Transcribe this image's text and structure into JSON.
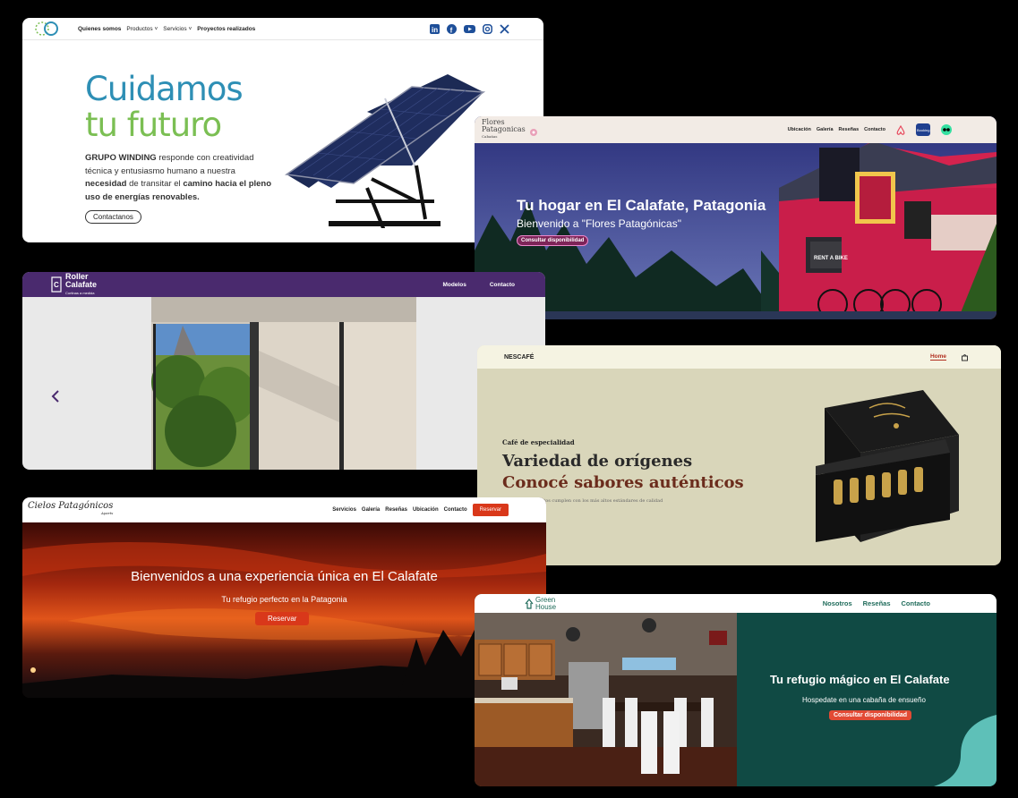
{
  "winding": {
    "nav": [
      "Quienes somos",
      "Productos ˅",
      "Servicios ˅",
      "Proyectos realizados"
    ],
    "social_icons": [
      "linkedin-icon",
      "facebook-icon",
      "youtube-icon",
      "instagram-icon",
      "x-icon"
    ],
    "heading_line1": "Cuidamos",
    "heading_line2": "tu futuro",
    "para_brand": "GRUPO WINDING",
    "para_1": " responde con creatividad técnica y entusiasmo humano a nuestra ",
    "para_2": "necesidad",
    "para_3": " de transitar el ",
    "para_4": "camino hacia el pleno uso de energías renovables.",
    "button": "Contactanos"
  },
  "flores": {
    "logo_line1": "Flores",
    "logo_line2": "Patagonicas",
    "logo_line3": "Cabañas",
    "nav": [
      "Ubicación",
      "Galería",
      "Reseñas",
      "Contacto"
    ],
    "title": "Tu hogar en El Calafate, Patagonia",
    "subtitle": "Bienvenido a \"Flores Patagónicas\"",
    "button": "Consultar disponibilidad",
    "sign_text": "RENT A BIKE"
  },
  "roller": {
    "logo_line1": "Roller",
    "logo_line2": "Calafate",
    "logo_sub": "Cortinas a medida",
    "nav": [
      "Modelos",
      "Contacto"
    ]
  },
  "nescafe": {
    "brand": "NESCAFÉ",
    "nav_home": "Home",
    "kicker": "Café de especialidad",
    "heading_1": "Variedad de orígenes",
    "heading_2": "Conocé sabores auténticos",
    "para": "ductos cumplen con los más altos estándares de calidad"
  },
  "cielos": {
    "logo": "Cielos Patagónicos",
    "logo_sub": "Aparts",
    "nav": [
      "Servicios",
      "Galería",
      "Reseñas",
      "Ubicación",
      "Contacto"
    ],
    "nav_button": "Reservar",
    "title": "Bienvenidos a una experiencia única en El Calafate",
    "subtitle": "Tu refugio perfecto en la Patagonia",
    "button": "Reservar"
  },
  "greenhouse": {
    "logo_line1": "Green",
    "logo_line2": "House",
    "nav": [
      "Nosotros",
      "Reseñas",
      "Contacto"
    ],
    "title": "Tu refugio mágico en El Calafate",
    "subtitle": "Hospedate en una cabaña de ensueño",
    "button": "Consultar disponibilidad"
  }
}
